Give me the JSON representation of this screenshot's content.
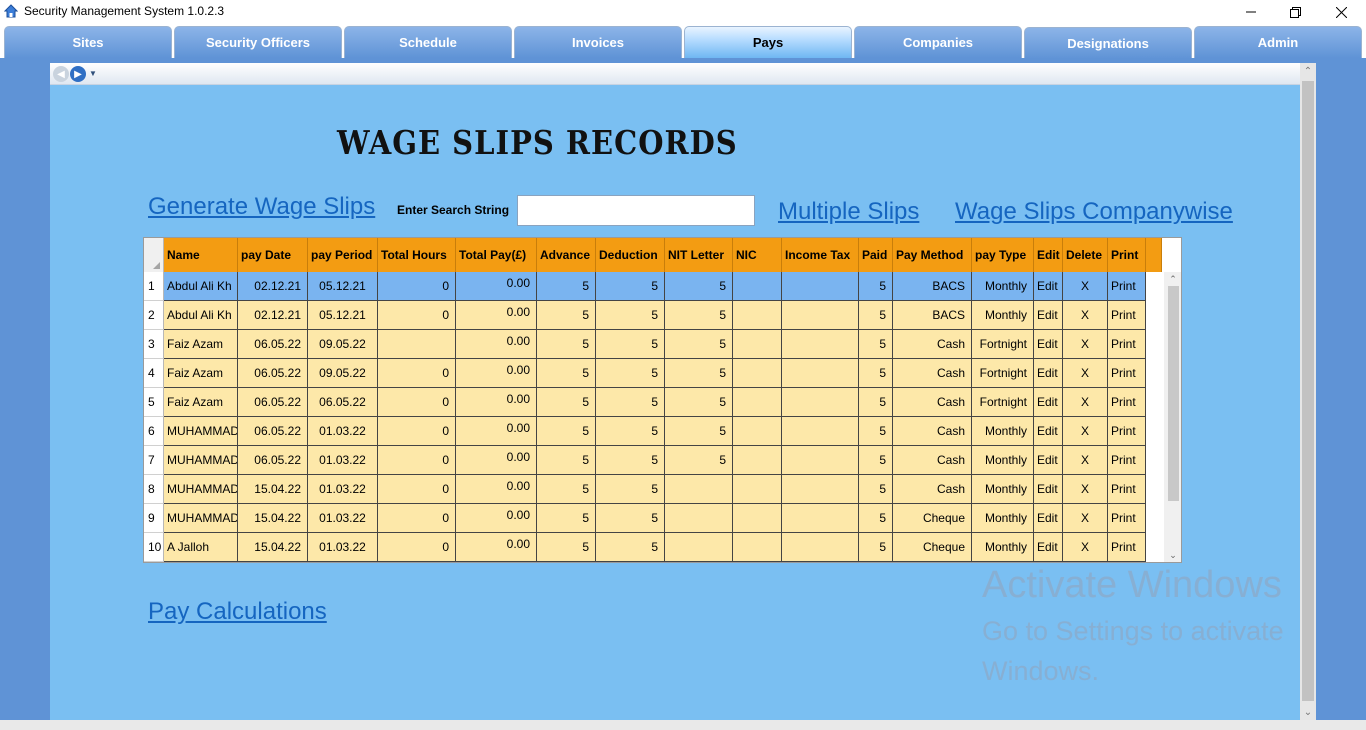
{
  "window": {
    "title": "Security Management System 1.0.2.3"
  },
  "tabs": [
    {
      "label": "Sites",
      "active": false
    },
    {
      "label": "Security Officers",
      "active": false
    },
    {
      "label": "Schedule",
      "active": false
    },
    {
      "label": "Invoices",
      "active": false
    },
    {
      "label": "Pays",
      "active": true
    },
    {
      "label": "Companies",
      "active": false
    },
    {
      "label": "Designations",
      "active": false
    },
    {
      "label": "Admin",
      "active": false
    }
  ],
  "page": {
    "title": "WAGE SLIPS RECORDS",
    "links": {
      "generate": "Generate Wage Slips",
      "multiple": "Multiple Slips",
      "companywise": "Wage Slips Companywise",
      "pay_calc": "Pay Calculations"
    },
    "search": {
      "label": "Enter Search String",
      "value": ""
    }
  },
  "grid": {
    "columns": [
      "Name",
      "pay Date",
      "pay Period",
      "Total Hours",
      "Total Pay(£)",
      "Advance",
      "Deduction",
      "NIT Letter",
      "NIC",
      "Income Tax",
      "Paid",
      "Pay Method",
      "pay Type",
      "Edit",
      "Delete",
      "Print"
    ],
    "rows": [
      {
        "num": "1",
        "cells": [
          "Abdul Ali Kh",
          "02.12.21",
          "05.12.21",
          "0",
          "0.00",
          "5",
          "5",
          "5",
          "",
          "",
          "5",
          "BACS",
          "Monthly",
          "Edit",
          "X",
          "Print"
        ]
      },
      {
        "num": "2",
        "cells": [
          "Abdul Ali Kh",
          "02.12.21",
          "05.12.21",
          "0",
          "0.00",
          "5",
          "5",
          "5",
          "",
          "",
          "5",
          "BACS",
          "Monthly",
          "Edit",
          "X",
          "Print"
        ]
      },
      {
        "num": "3",
        "cells": [
          "Faiz  Azam",
          "06.05.22",
          "09.05.22",
          "",
          "0.00",
          "5",
          "5",
          "5",
          "",
          "",
          "5",
          "Cash",
          "Fortnight",
          "Edit",
          "X",
          "Print"
        ]
      },
      {
        "num": "4",
        "cells": [
          "Faiz  Azam",
          "06.05.22",
          "09.05.22",
          "0",
          "0.00",
          "5",
          "5",
          "5",
          "",
          "",
          "5",
          "Cash",
          "Fortnight",
          "Edit",
          "X",
          "Print"
        ]
      },
      {
        "num": "5",
        "cells": [
          "Faiz  Azam",
          "06.05.22",
          "06.05.22",
          "0",
          "0.00",
          "5",
          "5",
          "5",
          "",
          "",
          "5",
          "Cash",
          "Fortnight",
          "Edit",
          "X",
          "Print"
        ]
      },
      {
        "num": "6",
        "cells": [
          "MUHAMMAD",
          "06.05.22",
          "01.03.22",
          "0",
          "0.00",
          "5",
          "5",
          "5",
          "",
          "",
          "5",
          "Cash",
          "Monthly",
          "Edit",
          "X",
          "Print"
        ]
      },
      {
        "num": "7",
        "cells": [
          "MUHAMMAD",
          "06.05.22",
          "01.03.22",
          "0",
          "0.00",
          "5",
          "5",
          "5",
          "",
          "",
          "5",
          "Cash",
          "Monthly",
          "Edit",
          "X",
          "Print"
        ]
      },
      {
        "num": "8",
        "cells": [
          "MUHAMMAD",
          "15.04.22",
          "01.03.22",
          "0",
          "0.00",
          "5",
          "5",
          "",
          "",
          "",
          "5",
          "Cash",
          "Monthly",
          "Edit",
          "X",
          "Print"
        ]
      },
      {
        "num": "9",
        "cells": [
          "MUHAMMAD",
          "15.04.22",
          "01.03.22",
          "0",
          "0.00",
          "5",
          "5",
          "",
          "",
          "",
          "5",
          "Cheque",
          "Monthly",
          "Edit",
          "X",
          "Print"
        ]
      },
      {
        "num": "10",
        "cells": [
          "A Jalloh",
          "15.04.22",
          "01.03.22",
          "0",
          "0.00",
          "5",
          "5",
          "",
          "",
          "",
          "5",
          "Cheque",
          "Monthly",
          "Edit",
          "X",
          "Print"
        ]
      }
    ]
  },
  "watermark": {
    "line1": "Activate Windows",
    "line2": "Go to Settings to activate",
    "line3": "Windows."
  },
  "colors": {
    "header_orange": "#f39c12",
    "row_fill": "#fde8a9",
    "selected_row": "#7ab4f0",
    "content_bg": "#7abff2",
    "link": "#1565c0"
  }
}
